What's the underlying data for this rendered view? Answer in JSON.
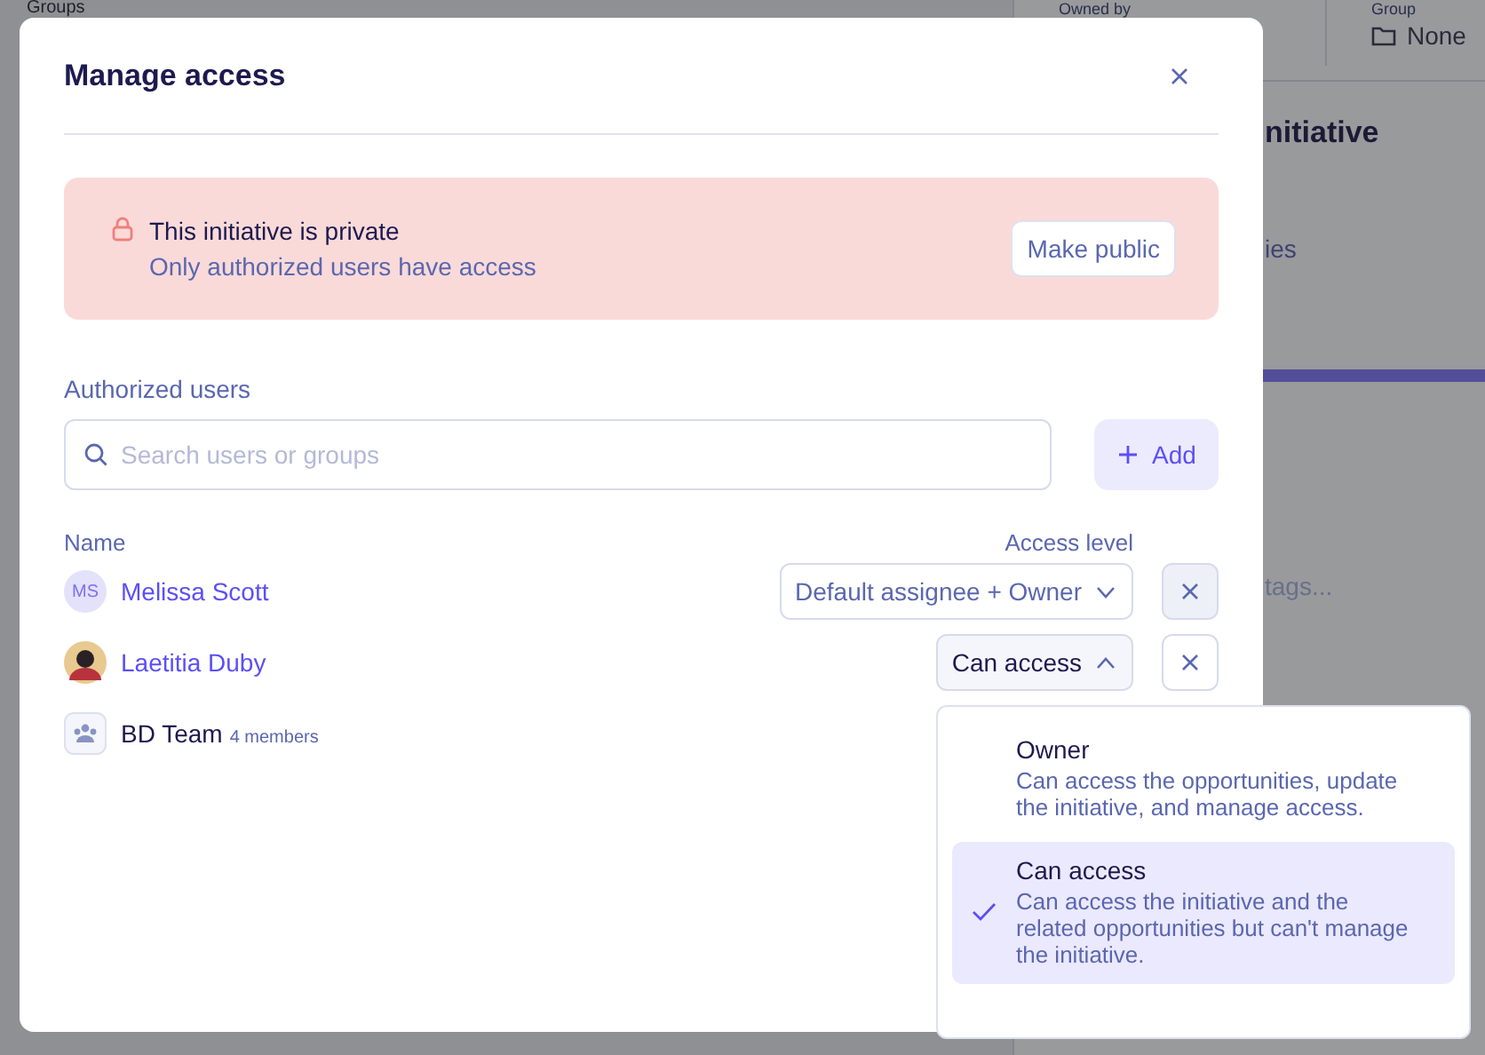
{
  "background": {
    "groups_label": "Groups",
    "owned_by_label": "Owned by",
    "group_label": "Group",
    "group_value": "None",
    "title_fragment": "nitiative",
    "text_fragment": "ies",
    "tags_placeholder": "tags..."
  },
  "dialog": {
    "title": "Manage access",
    "alert": {
      "title": "This initiative is private",
      "subtitle": "Only authorized users have access",
      "button": "Make public"
    },
    "section_label": "Authorized users",
    "search": {
      "placeholder": "Search users or groups"
    },
    "add_button": "Add",
    "columns": {
      "name": "Name",
      "access": "Access level"
    },
    "members": [
      {
        "kind": "initials",
        "initials": "MS",
        "name": "Melissa Scott",
        "access": "Default assignee + Owner",
        "expanded": false
      },
      {
        "kind": "photo",
        "name": "Laetitia Duby",
        "access": "Can access",
        "expanded": true
      },
      {
        "kind": "group",
        "name": "BD Team",
        "members": "4 members"
      }
    ]
  },
  "access_menu": [
    {
      "label": "Owner",
      "description": "Can access the opportunities, update the initiative, and manage access.",
      "selected": false
    },
    {
      "label": "Can access",
      "description": "Can access the initiative and the related opportunities but can't manage the initiative.",
      "selected": true
    }
  ]
}
